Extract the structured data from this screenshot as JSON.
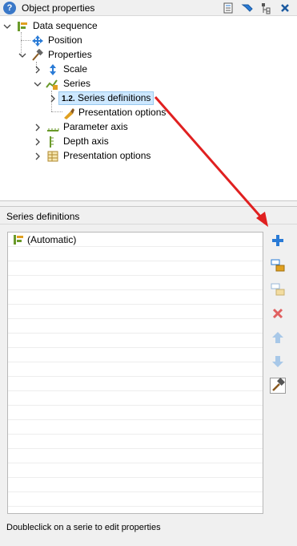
{
  "window": {
    "title": "Object properties"
  },
  "tree": {
    "data_sequence": "Data sequence",
    "position": "Position",
    "properties": "Properties",
    "scale": "Scale",
    "series": "Series",
    "series_definitions": "Series definitions",
    "series_definitions_badge": "1.2.",
    "series_presentation_options": "Presentation options",
    "parameter_axis": "Parameter axis",
    "depth_axis": "Depth axis",
    "presentation_options": "Presentation options"
  },
  "panel": {
    "title": "Series definitions",
    "list": [
      {
        "label": "(Automatic)"
      }
    ],
    "status": "Doubleclick on a serie to edit properties"
  },
  "colors": {
    "selection_bg": "#cde8ff",
    "selection_border": "#99c9ef",
    "annotation_arrow": "#e02020",
    "add_blue": "#2a7bd6",
    "delete_red": "#e06060"
  },
  "icons": {
    "toolbar": [
      "properties-icon",
      "pin-icon",
      "tree-icon",
      "close-icon"
    ],
    "side": [
      "add-icon",
      "edit-series-icon",
      "copy-series-icon",
      "delete-icon",
      "move-up-icon",
      "move-down-icon",
      "hammer-icon"
    ]
  }
}
